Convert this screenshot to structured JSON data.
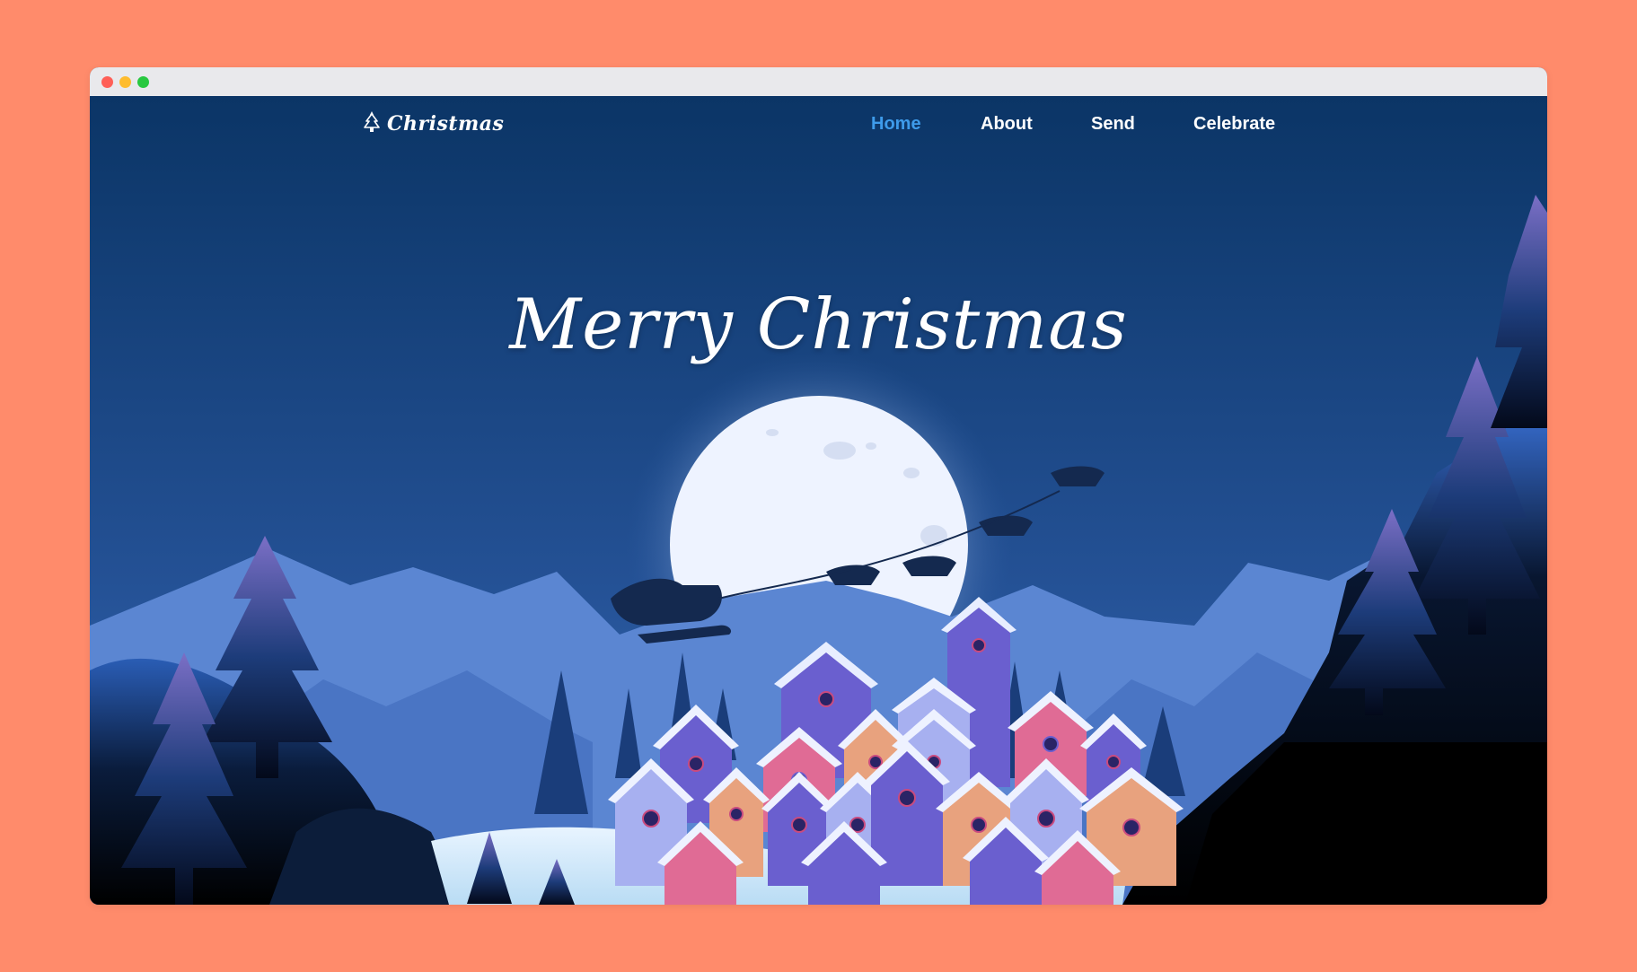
{
  "browser": {
    "controls": [
      "close",
      "minimize",
      "maximize"
    ]
  },
  "brand": {
    "text": "Christmas",
    "icon": "christmas-tree-icon"
  },
  "nav": {
    "items": [
      {
        "label": "Home",
        "active": true
      },
      {
        "label": "About",
        "active": false
      },
      {
        "label": "Send",
        "active": false
      },
      {
        "label": "Celebrate",
        "active": false
      }
    ]
  },
  "hero": {
    "title": "Merry Christmas"
  },
  "colors": {
    "page_background": "#FF8B6B",
    "sky_top": "#0B3566",
    "sky_bottom": "#2F5FA7",
    "active_link": "#3E9BEA",
    "moon": "#EEF3FF"
  }
}
